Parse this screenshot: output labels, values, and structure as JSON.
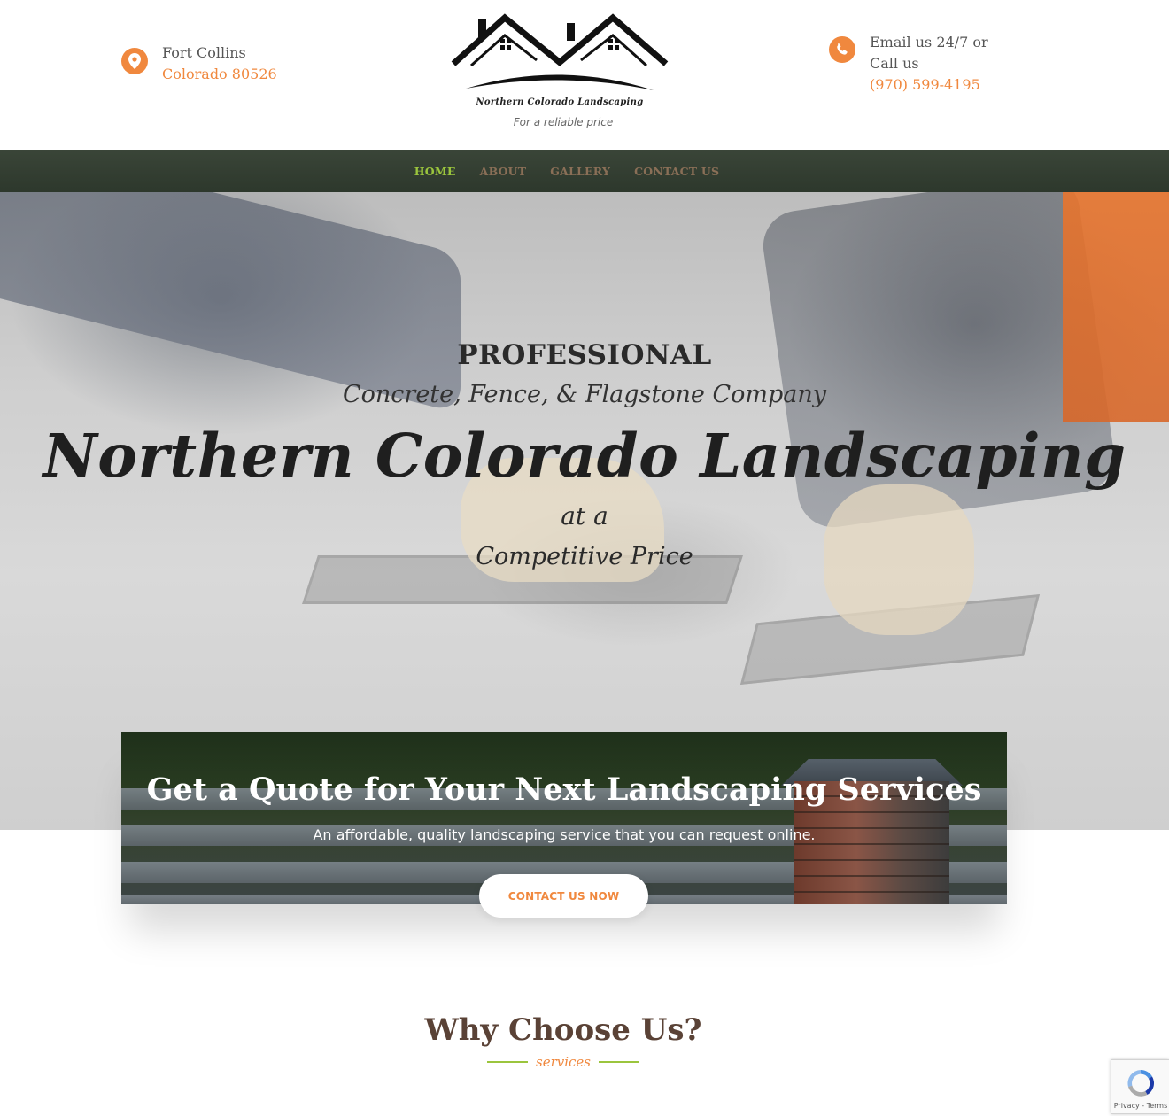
{
  "header": {
    "location": {
      "line1": "Fort Collins",
      "line2": "Colorado 80526"
    },
    "contact": {
      "line1": "Email us 24/7 or",
      "line2": "Call us",
      "phone": "(970) 599-4195"
    },
    "logo": {
      "name": "Northern Colorado Landscaping",
      "tagline": "For a reliable price"
    }
  },
  "nav": {
    "items": [
      {
        "label": "HOME",
        "active": true
      },
      {
        "label": "ABOUT",
        "active": false
      },
      {
        "label": "GALLERY",
        "active": false
      },
      {
        "label": "CONTACT US",
        "active": false
      }
    ]
  },
  "hero": {
    "eyebrow": "PROFESSIONAL",
    "subtitle": "Concrete, Fence, & Flagstone Company",
    "title": "Northern Colorado Landscaping",
    "line1": "at a",
    "line2": "Competitive Price"
  },
  "quote": {
    "title": "Get a Quote for Your Next Landscaping Services",
    "subtitle": "An affordable, quality landscaping service that you can request online.",
    "button": "CONTACT US NOW"
  },
  "why": {
    "title": "Why Choose Us?",
    "label": "services"
  },
  "recaptcha": {
    "links": "Privacy - Terms"
  },
  "colors": {
    "accent": "#f0883e",
    "nav_active": "#9bc53d",
    "nav_bg": "#2d382c",
    "heading_brown": "#5a4236"
  },
  "icons": {
    "location": "map-pin-icon",
    "phone": "phone-icon",
    "recaptcha": "recaptcha-icon"
  }
}
